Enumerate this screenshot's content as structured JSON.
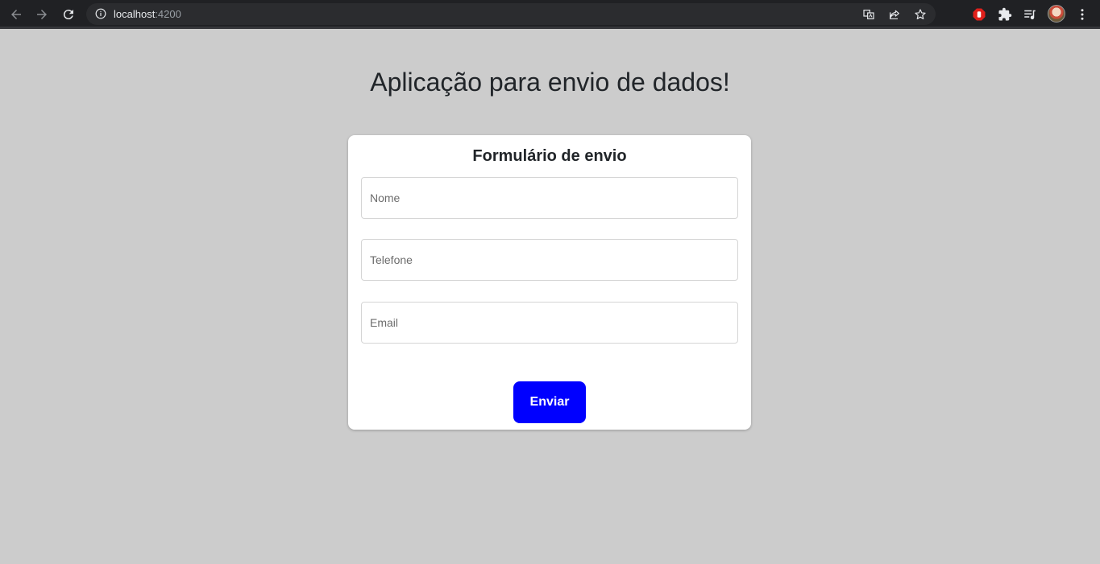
{
  "browser": {
    "url_host": "localhost",
    "url_port": ":4200",
    "icons": [
      "back-arrow-icon",
      "forward-arrow-icon",
      "reload-icon",
      "site-info-icon",
      "translate-icon",
      "share-icon",
      "bookmark-star-icon",
      "adblock-icon",
      "extensions-puzzle-icon",
      "media-queue-icon",
      "profile-avatar",
      "kebab-menu-icon"
    ]
  },
  "page": {
    "heading": "Aplicação para envio de dados!"
  },
  "form": {
    "title": "Formulário de envio",
    "fields": [
      {
        "placeholder": "Nome",
        "value": ""
      },
      {
        "placeholder": "Telefone",
        "value": ""
      },
      {
        "placeholder": "Email",
        "value": ""
      }
    ],
    "submit_label": "Enviar"
  },
  "colors": {
    "page_background": "#cccccc",
    "card_background": "#ffffff",
    "submit_button": "#0000ff",
    "chrome_background": "#202124"
  }
}
